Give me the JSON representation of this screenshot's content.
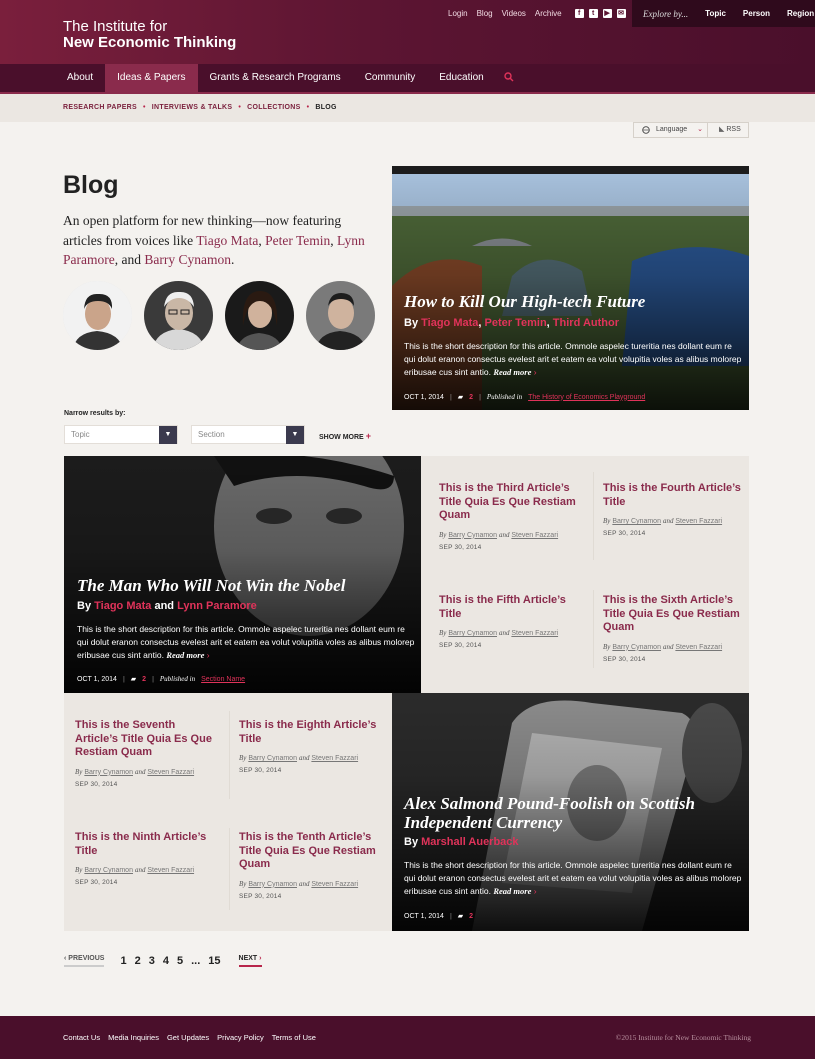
{
  "header": {
    "logo_line1": "The Institute for",
    "logo_line2": "New Economic Thinking",
    "util_links": [
      "Login",
      "Blog",
      "Videos",
      "Archive"
    ],
    "social_icons": [
      "facebook-icon",
      "twitter-icon",
      "youtube-icon",
      "email-icon"
    ],
    "explore_label": "Explore by...",
    "explore_options": [
      "Topic",
      "Person",
      "Region"
    ],
    "nav": [
      "About",
      "Ideas & Papers",
      "Grants & Research Programs",
      "Community",
      "Education"
    ],
    "nav_active": "Ideas & Papers",
    "search_icon": "search-icon"
  },
  "breadcrumb": [
    "RESEARCH PAPERS",
    "INTERVIEWS & TALKS",
    "COLLECTIONS",
    "BLOG"
  ],
  "language": {
    "label": "Language",
    "rss": "RSS"
  },
  "intro": {
    "title": "Blog",
    "text_before": "An open platform for new thinking—now featuring articles from voices like ",
    "names": [
      "Tiago Mata",
      "Peter Temin",
      "Lynn Paramore",
      "Barry Cynamon"
    ],
    "sep1": ", ",
    "sep2": ", ",
    "sep3": ", and ",
    "end": "."
  },
  "featured_top": {
    "title": "How to Kill Our High-tech Future",
    "by": "By",
    "authors": [
      "Tiago Mata",
      "Peter Temin",
      "Third Author"
    ],
    "desc": "This is the short description for this article. Ommole aspelec tureritia nes dollant eum re qui dolut eranon consectus evelest arit et eatem ea volut volupitia voles as alibus molorep eribusae cus sint antio.",
    "read_more": "Read more",
    "date": "OCT 1, 2014",
    "comments": "2",
    "published_in": "Published in",
    "section": "The History of Economics Playground"
  },
  "filters": {
    "label": "Narrow results by:",
    "topic_placeholder": "Topic",
    "section_placeholder": "Section",
    "show_more": "SHOW MORE"
  },
  "featured_mid": {
    "title": "The Man Who Will Not Win the Nobel",
    "by": "By",
    "author1": "Tiago Mata",
    "and": "and",
    "author2": "Lynn Paramore",
    "desc": "This is the short description for this article. Ommole aspelec tureritia nes dollant eum re qui dolut eranon consectus evelest arit et eatem ea volut volupitia voles as alibus molorep eribusae cus sint antio.",
    "read_more": "Read more",
    "date": "OCT 1, 2014",
    "comments": "2",
    "published_in": "Published in",
    "section": "Section Name"
  },
  "featured_bottom": {
    "title": "Alex Salmond Pound-Foolish on Scottish Independent Currency",
    "by": "By",
    "author": "Marshall Auerback",
    "desc": "This is the short description for this article. Ommole aspelec tureritia nes dollant eum re qui dolut eranon consectus evelest arit et eatem ea volut volupitia voles as alibus molorep eribusae cus sint antio.",
    "read_more": "Read more",
    "date": "OCT 1, 2014",
    "comments": "2"
  },
  "cards": [
    {
      "title": "This is the Third Article’s Title Quia Es Que Restiam Quam",
      "by": "By",
      "a1": "Barry Cynamon",
      "and": "and",
      "a2": "Steven Fazzari",
      "date": "SEP 30, 2014"
    },
    {
      "title": "This is the Fourth Article’s Title",
      "by": "By",
      "a1": "Barry Cynamon",
      "and": "and",
      "a2": "Steven Fazzari",
      "date": "SEP 30, 2014"
    },
    {
      "title": "This is the Fifth Article’s Title",
      "by": "By",
      "a1": "Barry Cynamon",
      "and": "and",
      "a2": "Steven Fazzari",
      "date": "SEP 30, 2014"
    },
    {
      "title": "This is the Sixth Article’s Title Quia Es Que Restiam Quam",
      "by": "By",
      "a1": "Barry Cynamon",
      "and": "and",
      "a2": "Steven Fazzari",
      "date": "SEP 30, 2014"
    },
    {
      "title": "This is the Seventh Article’s Title Quia Es Que Restiam Quam",
      "by": "By",
      "a1": "Barry Cynamon",
      "and": "and",
      "a2": "Steven Fazzari",
      "date": "SEP 30, 2014"
    },
    {
      "title": "This is the Eighth Article’s Title",
      "by": "By",
      "a1": "Barry Cynamon",
      "and": "and",
      "a2": "Steven Fazzari",
      "date": "SEP 30, 2014"
    },
    {
      "title": "This is the Ninth Article’s Title",
      "by": "By",
      "a1": "Barry Cynamon",
      "and": "and",
      "a2": "Steven Fazzari",
      "date": "SEP 30, 2014"
    },
    {
      "title": "This is the Tenth Article’s Title Quia Es Que Restiam Quam",
      "by": "By",
      "a1": "Barry Cynamon",
      "and": "and",
      "a2": "Steven Fazzari",
      "date": "SEP 30, 2014"
    }
  ],
  "pagination": {
    "prev": "PREVIOUS",
    "pages": [
      "1",
      "2",
      "3",
      "4",
      "5"
    ],
    "ellipsis": "...",
    "last": "15",
    "next": "NEXT"
  },
  "footer": {
    "links": [
      "Contact Us",
      "Media Inquiries",
      "Get Updates",
      "Privacy Policy",
      "Terms of Use"
    ],
    "copyright": "©2015 Institute for New Economic Thinking"
  },
  "colors": {
    "brand": "#7a1f3c",
    "dark_brand": "#4a0f2b",
    "accent": "#e0335a"
  }
}
